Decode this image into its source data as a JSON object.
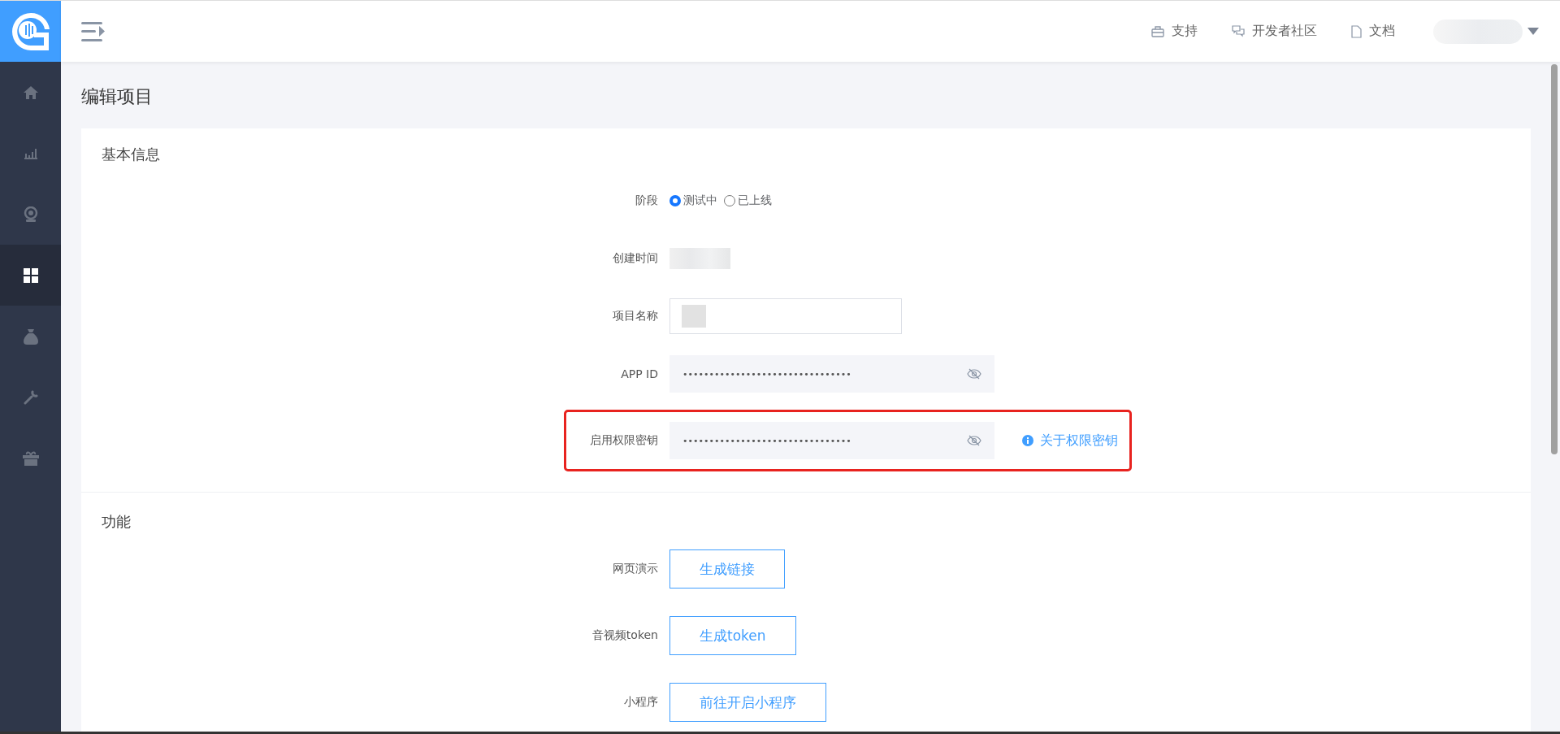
{
  "sidebar": {
    "items": [
      {
        "kind": "home",
        "selected": false
      },
      {
        "kind": "chart",
        "selected": false
      },
      {
        "kind": "camera",
        "selected": false
      },
      {
        "kind": "grid",
        "selected": true
      },
      {
        "kind": "moneybag",
        "selected": false
      },
      {
        "kind": "wrench",
        "selected": false
      },
      {
        "kind": "gift",
        "selected": false
      }
    ]
  },
  "header": {
    "links": [
      {
        "kind": "support",
        "label": "支持"
      },
      {
        "kind": "community",
        "label": "开发者社区"
      },
      {
        "kind": "docs",
        "label": "文档"
      }
    ]
  },
  "page_title": "编辑项目",
  "sections": [
    {
      "title": "基本信息",
      "rows": [
        {
          "kind": "radio",
          "label": "阶段",
          "options": [
            {
              "label": "测试中",
              "selected": true
            },
            {
              "label": "已上线",
              "selected": false
            }
          ]
        },
        {
          "kind": "blurred",
          "label": "创建时间"
        },
        {
          "kind": "blurred-input",
          "label": "项目名称"
        },
        {
          "kind": "secret",
          "label": "APP ID",
          "value": "••••••••••••••••••••••••••••••••",
          "highlighted": false
        },
        {
          "kind": "secret",
          "label": "启用权限密钥",
          "value": "••••••••••••••••••••••••••••••••",
          "highlighted": true,
          "link": "关于权限密钥"
        }
      ]
    },
    {
      "title": "功能",
      "rows": [
        {
          "kind": "button",
          "label": "网页演示",
          "button": "生成链接"
        },
        {
          "kind": "button",
          "label": "音视频token",
          "button": "生成token"
        },
        {
          "kind": "button",
          "label": "小程序",
          "button": "前往开启小程序"
        }
      ]
    }
  ]
}
